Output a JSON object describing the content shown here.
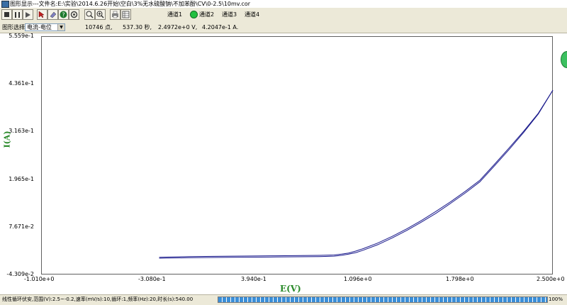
{
  "window": {
    "title": "图形显示---文件名:E:\\实验\\2014.6.26开始\\空白\\3%无水硫酸钠\\不加苯酚\\CV\\0-2.5\\10mv.cor"
  },
  "toolbar": {
    "buttons": [
      "stop-icon",
      "pause-icon",
      "cursor-icon",
      "eraser-icon",
      "help-icon",
      "zoom-out-icon",
      "zoom-in-icon",
      "print-icon",
      "table-icon"
    ],
    "channels": [
      "通道1",
      "通道2",
      "通道3",
      "通道4"
    ],
    "active_channel_color": "#22c040"
  },
  "status": {
    "plot_type_label": "图形选择",
    "plot_type_value": "电流-电位",
    "points": "10746 点,",
    "time": "537.30 秒,",
    "potential": "2.4972e+0  V,",
    "current": "4.2047e-1  A."
  },
  "bottom": {
    "message": "线性循环伏安,范围(V):2.5~-0.2,速率(mV/s):10,循环:1,频率(Hz):20,时长(s):540.00",
    "progress": 1.0,
    "progress_label": "100%"
  },
  "chart_data": {
    "type": "line",
    "xlabel": "E(V)",
    "ylabel": "I(A)",
    "xlim": [
      -1.01,
      2.5
    ],
    "ylim": [
      -0.04309,
      0.5559
    ],
    "x_ticks": [
      "-1.010e+0",
      "-3.080e-1",
      "3.940e-1",
      "1.096e+0",
      "1.798e+0",
      "2.500e+0"
    ],
    "y_ticks": [
      "5.559e-1",
      "4.361e-1",
      "3.163e-1",
      "1.965e-1",
      "7.671e-2",
      "-4.309e-2"
    ],
    "line_color": "#1a1a8c",
    "series": [
      {
        "x": [
          -0.2,
          0.0,
          0.3,
          0.6,
          0.9,
          1.0,
          1.05,
          1.1,
          1.15,
          1.2,
          1.3,
          1.4,
          1.5,
          1.6,
          1.7,
          1.8,
          1.9,
          2.0,
          2.1,
          2.2,
          2.3,
          2.4,
          2.5
        ],
        "y": [
          0.0,
          0.002,
          0.003,
          0.004,
          0.005,
          0.006,
          0.008,
          0.011,
          0.016,
          0.022,
          0.036,
          0.053,
          0.072,
          0.093,
          0.116,
          0.14,
          0.166,
          0.194,
          0.234,
          0.275,
          0.317,
          0.362,
          0.42
        ]
      },
      {
        "x": [
          2.5,
          2.4,
          2.3,
          2.2,
          2.1,
          2.0,
          1.9,
          1.8,
          1.7,
          1.6,
          1.5,
          1.4,
          1.3,
          1.2,
          1.15,
          1.1,
          1.05,
          1.0,
          0.9,
          0.6,
          0.3,
          0.0,
          -0.2
        ],
        "y": [
          0.42,
          0.36,
          0.314,
          0.271,
          0.23,
          0.19,
          0.162,
          0.136,
          0.111,
          0.089,
          0.068,
          0.049,
          0.032,
          0.018,
          0.012,
          0.008,
          0.005,
          0.003,
          0.002,
          0.001,
          0.0,
          -0.001,
          -0.002
        ]
      }
    ]
  }
}
